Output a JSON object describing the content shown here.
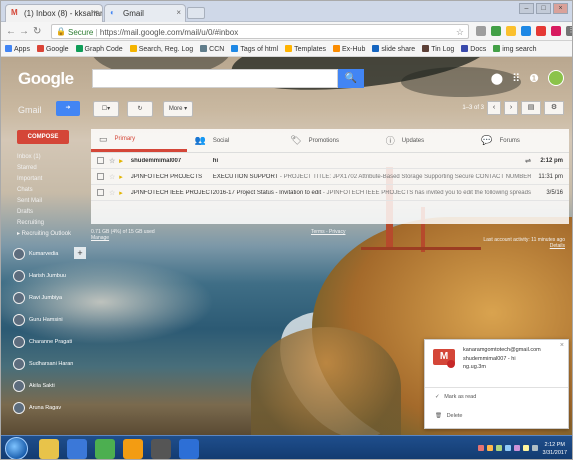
{
  "browser": {
    "tabs": [
      {
        "icon": "M",
        "label": "(1) Inbox (8) - kksaharan - x"
      },
      {
        "icon": "◐",
        "label": "Gmail"
      }
    ],
    "url": "https://mail.google.com/mail/u/0/#inbox",
    "secure_label": "Secure",
    "bookmarks": [
      {
        "label": "Apps",
        "color": "#4285f4"
      },
      {
        "label": "Google",
        "color": "#db4437"
      },
      {
        "label": "Graph Code",
        "color": "#0f9d58"
      },
      {
        "label": "Search, Reg. Log",
        "color": "#f4b400"
      },
      {
        "label": "CCN",
        "color": "#607d8b"
      },
      {
        "label": "Tags of html",
        "color": "#1e88e5"
      },
      {
        "label": "Templates",
        "color": "#ffb300"
      },
      {
        "label": "Ex-Hub",
        "color": "#fb8c00"
      },
      {
        "label": "slide share",
        "color": "#1565c0"
      },
      {
        "label": "Tin Log",
        "color": "#5d4037"
      },
      {
        "label": "Docs",
        "color": "#3949ab"
      },
      {
        "label": "img search",
        "color": "#43a047"
      }
    ]
  },
  "gmail": {
    "logo": "Google",
    "app_label": "Gmail",
    "compose_label": "COMPOSE",
    "more_label": "More",
    "page_info": "1–3 of 3",
    "labels": [
      "Inbox (1)",
      "Starred",
      "Important",
      "Chats",
      "Sent Mail",
      "Drafts",
      "Recruiting",
      "▸ Recruiting Outlook"
    ],
    "tabs": [
      {
        "label": "Primary",
        "icon": "inbox-icon",
        "glyph": "▭"
      },
      {
        "label": "Social",
        "icon": "people-icon",
        "glyph": "👥"
      },
      {
        "label": "Promotions",
        "icon": "tag-icon",
        "glyph": "🏷"
      },
      {
        "label": "Updates",
        "icon": "info-icon",
        "glyph": "ⓘ"
      },
      {
        "label": "Forums",
        "icon": "forum-icon",
        "glyph": "💬"
      }
    ],
    "emails": [
      {
        "sender": "shudemmimal007",
        "subject": "hi",
        "snippet": "",
        "date": "2:12 pm",
        "unread": true,
        "attachment": "⇌"
      },
      {
        "sender": "JPINFOTECH PROJECTS",
        "subject": "EXECUTION SUPPORT",
        "snippet": " - PROJECT TITLE: JPX1702 Attribute-Based Storage Supporting Secure CONTACT NUMBER: 0413-4006",
        "date": "11:31 pm",
        "unread": false,
        "attachment": ""
      },
      {
        "sender": "JPINFOTECH IEEE PROJECTS",
        "subject": "2016-17 Project Status - Invitation to edit",
        "snippet": " - JPINFOTECH IEEE PROJECTS has invited you to edit the following spreadsheet: 2016-",
        "date": "3/5/16",
        "unread": false,
        "attachment": ""
      }
    ],
    "footer": {
      "usage": "0.71 GB (4%) of 15 GB used",
      "manage": "Manage",
      "terms": "Terms - Privacy",
      "activity": "Last account activity: 11 minutes ago",
      "details": "Details"
    },
    "contacts": [
      "Kumarvedia",
      "Harish Jumbuu",
      "Ravi Jumbiya",
      "Guru Hamsini",
      "Charanne Pragati",
      "Sudharsani Haran",
      "Akila Sakti",
      "Aruna Ragav"
    ]
  },
  "notification": {
    "from_email": "kanaramgomtotech@gmail.com",
    "sender": "shudemmimal007 - hi",
    "preview": "ng.ug.3m",
    "action_read": "Mark as read",
    "action_delete": "Delete"
  },
  "taskbar": {
    "time": "2:12 PM",
    "date": "3/31/2017",
    "app_colors": [
      "#e8c34a",
      "#3b78d8",
      "#4caf50",
      "#f39c12",
      "#555555",
      "#2d6fd6"
    ]
  }
}
